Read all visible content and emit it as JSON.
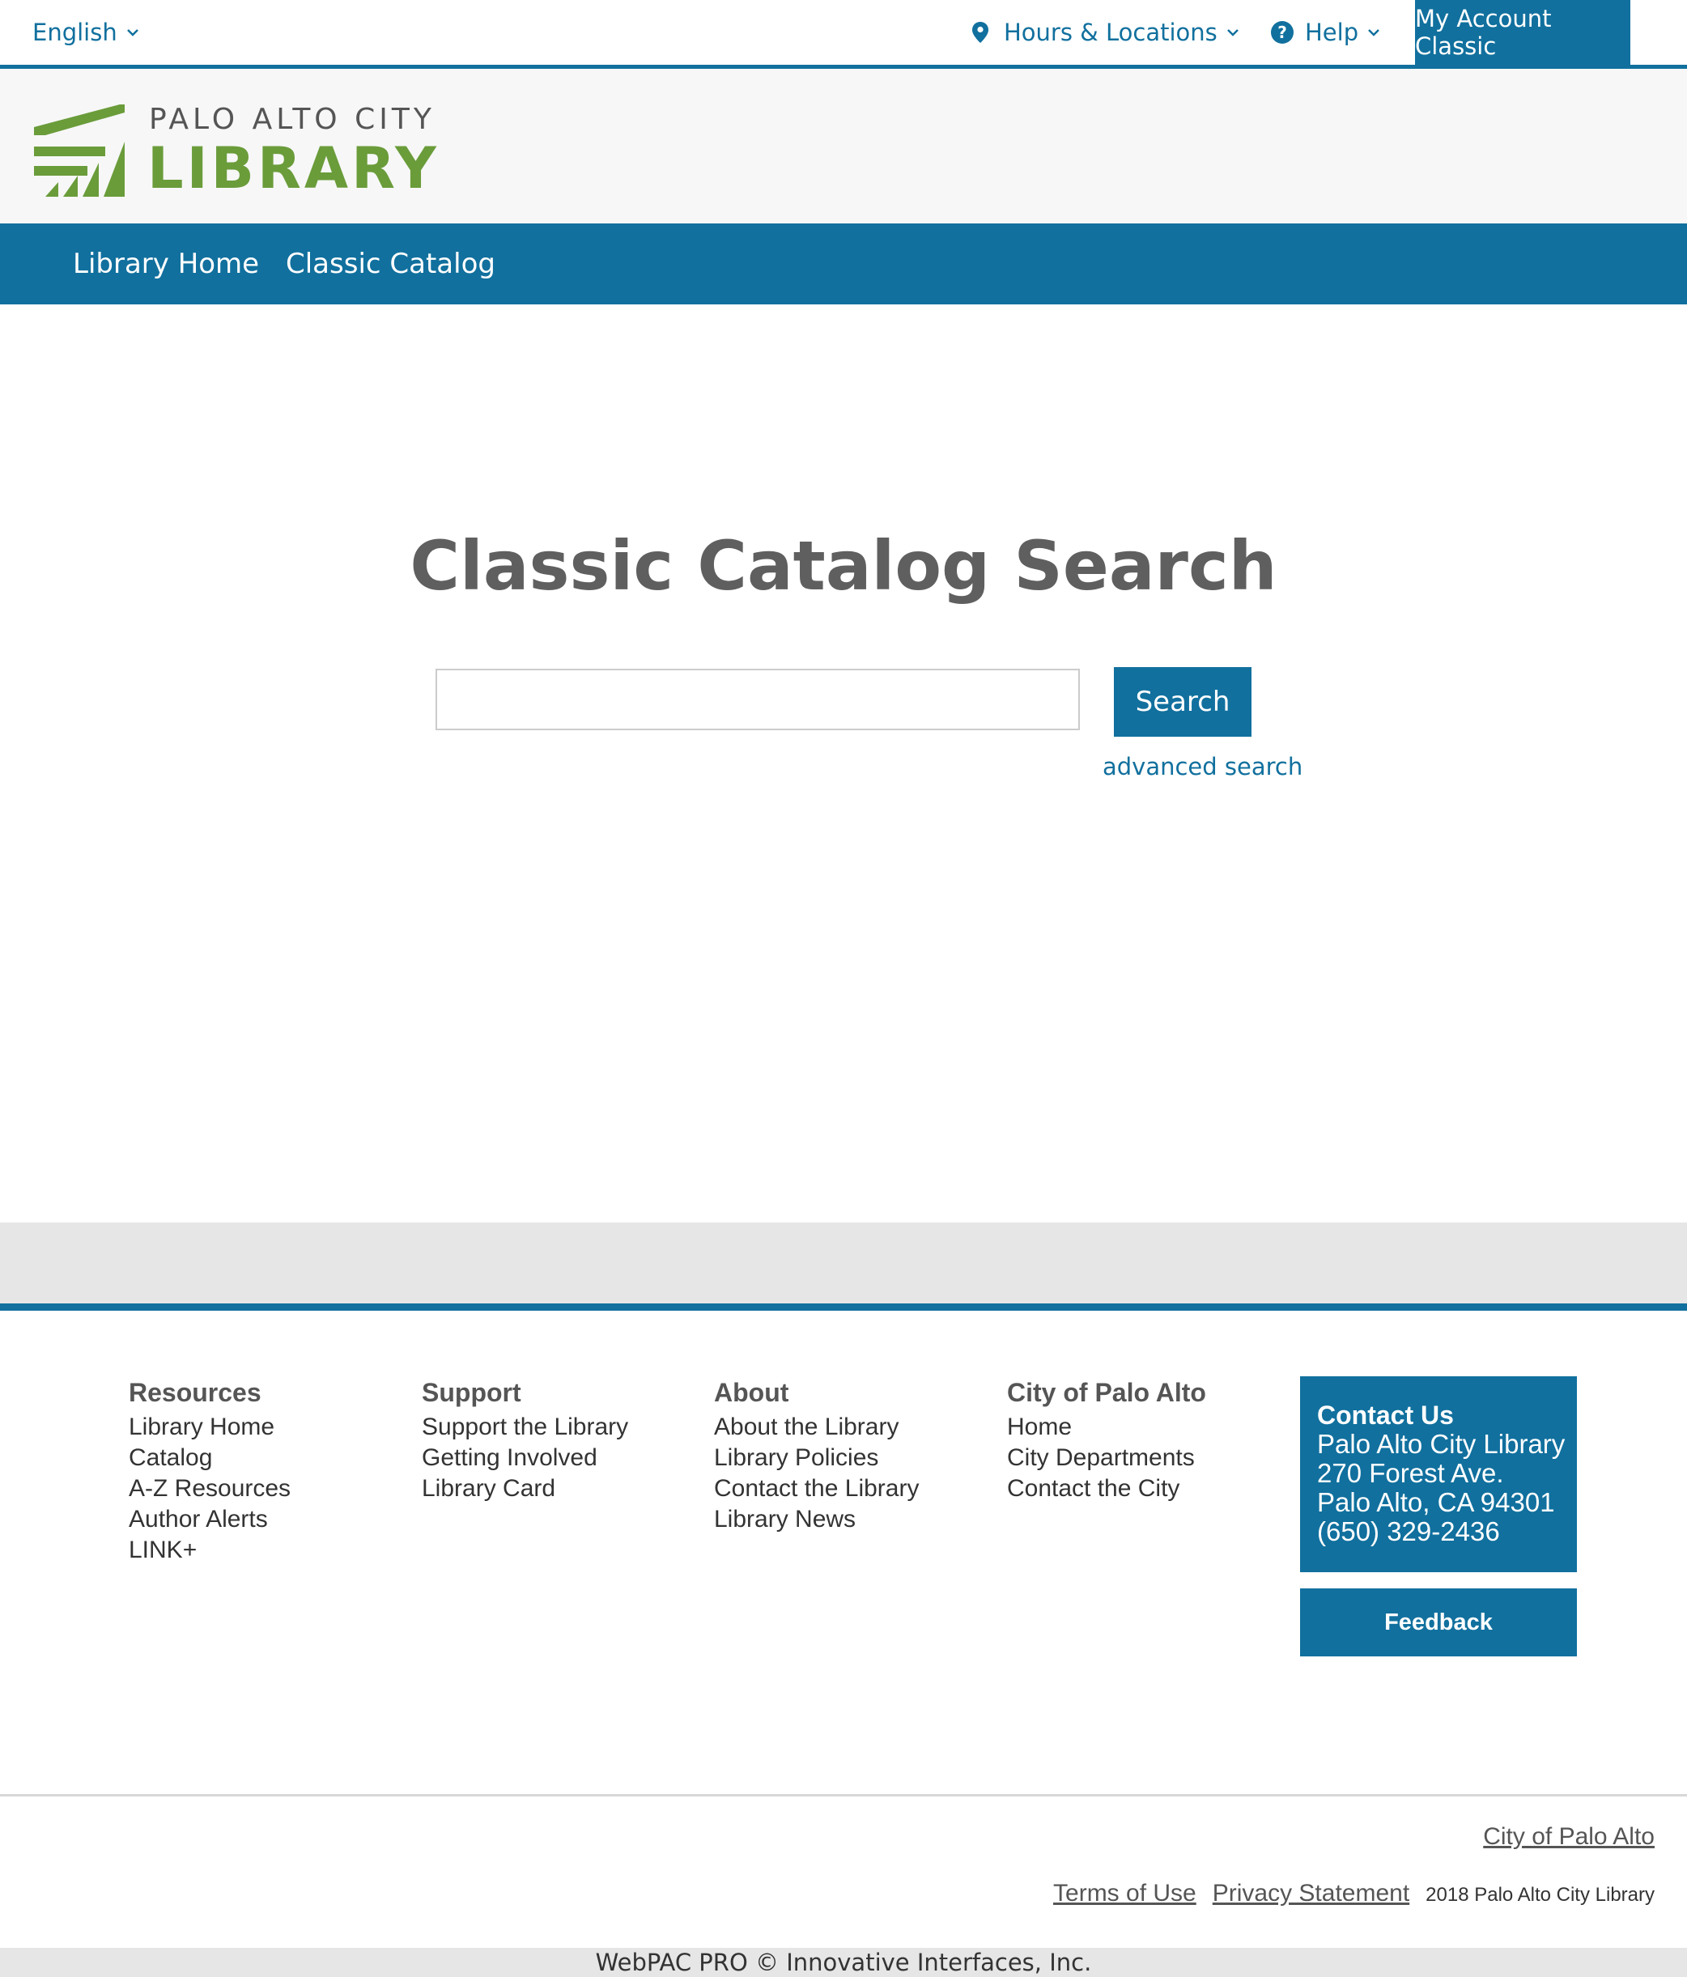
{
  "utility": {
    "language": "English",
    "hours_locations": "Hours & Locations",
    "help": "Help",
    "help_glyph": "?",
    "account": "My Account Classic"
  },
  "logo": {
    "line1": "PALO ALTO CITY",
    "line2": "LIBRARY",
    "brand_green": "#6a9c3a"
  },
  "nav": {
    "items": [
      {
        "label": "Library Home"
      },
      {
        "label": "Classic Catalog"
      }
    ]
  },
  "search": {
    "title": "Classic Catalog Search",
    "value": "",
    "button": "Search",
    "advanced": "advanced search"
  },
  "footer": {
    "columns": [
      {
        "heading": "Resources",
        "links": [
          "Library Home",
          "Catalog",
          "A-Z Resources",
          "Author Alerts",
          "LINK+"
        ]
      },
      {
        "heading": "Support",
        "links": [
          "Support the Library",
          "Getting Involved",
          "Library Card"
        ]
      },
      {
        "heading": "About",
        "links": [
          "About the Library",
          "Library Policies",
          "Contact the Library",
          "Library News"
        ]
      },
      {
        "heading": "City of Palo Alto",
        "links": [
          "Home",
          "City Departments",
          "Contact the City"
        ]
      }
    ],
    "contact": {
      "heading": "Contact Us",
      "name": "Palo Alto City Library",
      "street": "270 Forest Ave.",
      "city": "Palo Alto, CA 94301",
      "phone": "(650) 329-2436"
    },
    "feedback": "Feedback"
  },
  "legal": {
    "city_link": "City of Palo Alto",
    "terms": "Terms of Use",
    "privacy": "Privacy Statement",
    "copyright": "2018 Palo Alto City Library",
    "webpac": "WebPAC PRO © Innovative Interfaces, Inc."
  },
  "colors": {
    "primary": "#11709e",
    "band_gray": "#e6e6e6"
  },
  "icons": [
    "chevron-down-icon",
    "map-pin-icon",
    "help-circle-icon",
    "library-logo-icon"
  ]
}
